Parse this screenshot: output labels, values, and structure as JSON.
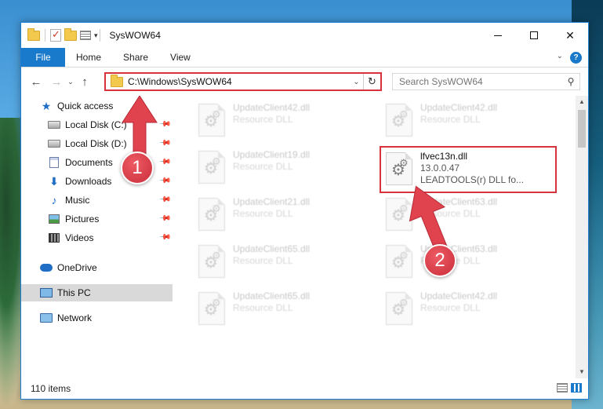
{
  "window": {
    "title": "SysWOW64",
    "controls": {
      "minimize": "minimize-icon",
      "maximize": "maximize-icon",
      "close": "✕"
    }
  },
  "ribbon": {
    "tabs": [
      "File",
      "Home",
      "Share",
      "View"
    ],
    "help": "?"
  },
  "address": {
    "path": "C:\\Windows\\SysWOW64",
    "search_placeholder": "Search SysWOW64"
  },
  "nav": {
    "items": [
      {
        "label": "Quick access",
        "icon": "star-icon",
        "pinned": false,
        "selected": false
      },
      {
        "label": "Local Disk (C:)",
        "icon": "drive-icon",
        "pinned": true,
        "selected": false
      },
      {
        "label": "Local Disk (D:)",
        "icon": "drive-icon",
        "pinned": true,
        "selected": false
      },
      {
        "label": "Documents",
        "icon": "documents-icon",
        "pinned": true,
        "selected": false
      },
      {
        "label": "Downloads",
        "icon": "downloads-icon",
        "pinned": true,
        "selected": false
      },
      {
        "label": "Music",
        "icon": "music-icon",
        "pinned": true,
        "selected": false
      },
      {
        "label": "Pictures",
        "icon": "pictures-icon",
        "pinned": true,
        "selected": false
      },
      {
        "label": "Videos",
        "icon": "videos-icon",
        "pinned": true,
        "selected": false
      },
      {
        "label": "OneDrive",
        "icon": "onedrive-icon",
        "pinned": false,
        "selected": false
      },
      {
        "label": "This PC",
        "icon": "this-pc-icon",
        "pinned": false,
        "selected": true
      },
      {
        "label": "Network",
        "icon": "network-icon",
        "pinned": false,
        "selected": false
      }
    ]
  },
  "files": [
    {
      "name": "UpdateClient42.dll",
      "type": "Resource DLL"
    },
    {
      "name": "UpdateClient42.dll",
      "type": "Resource DLL"
    },
    {
      "name": "UpdateClient19.dll",
      "type": "Resource DLL"
    },
    {
      "name": "lfvec13n.dll",
      "version": "13.0.0.47",
      "description": "LEADTOOLS(r) DLL fo..."
    },
    {
      "name": "UpdateClient21.dll",
      "type": "Resource DLL"
    },
    {
      "name": "UpdateClient63.dll",
      "type": "Resource DLL"
    },
    {
      "name": "UpdateClient65.dll",
      "type": "Resource DLL"
    },
    {
      "name": "UpdateClient63.dll",
      "type": "Resource DLL"
    },
    {
      "name": "UpdateClient65.dll",
      "type": "Resource DLL"
    },
    {
      "name": "UpdateClient42.dll",
      "type": "Resource DLL"
    }
  ],
  "status": {
    "item_count": "110 items"
  },
  "annotations": {
    "step1": "1",
    "step2": "2"
  },
  "colors": {
    "accent": "#1979ca",
    "highlight": "#d7333f"
  }
}
